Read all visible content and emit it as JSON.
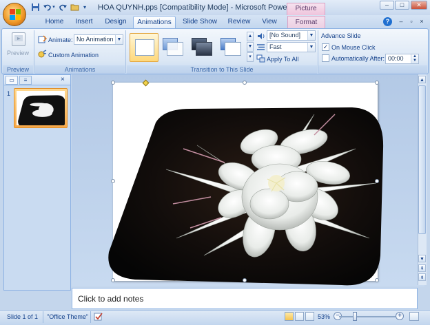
{
  "window": {
    "title": "HOA QUYNH.pps [Compatibility Mode] - Microsoft PowerPoint...",
    "contextual_tab_group": "Picture Tools",
    "controls": {
      "minimize": "–",
      "maximize": "□",
      "close": "✕"
    }
  },
  "quick_access_icons": [
    "save-icon",
    "undo-icon",
    "redo-icon",
    "open-folder-icon",
    "customize-qat-icon"
  ],
  "tabs": [
    "Home",
    "Insert",
    "Design",
    "Animations",
    "Slide Show",
    "Review",
    "View",
    "Format"
  ],
  "active_tab": "Animations",
  "ribbon": {
    "preview": {
      "button_label": "Preview",
      "group_label": "Preview"
    },
    "animations": {
      "animate_label": "Animate:",
      "animate_value": "No Animation",
      "custom_animation_label": "Custom Animation",
      "group_label": "Animations"
    },
    "transition": {
      "sound_value": "[No Sound]",
      "speed_value": "Fast",
      "apply_to_all_label": "Apply To All",
      "group_label": "Transition to This Slide",
      "gallery_icons": [
        "no-transition-icon",
        "fade-smoothly-icon",
        "fade-through-black-icon",
        "cut-transition-icon"
      ]
    },
    "advance": {
      "title": "Advance Slide",
      "on_mouse_click_label": "On Mouse Click",
      "on_mouse_click_checked": true,
      "auto_after_label": "Automatically After:",
      "auto_after_checked": false,
      "auto_after_value": "00:00"
    }
  },
  "slide_pane": {
    "slide_number": "1"
  },
  "notes": {
    "placeholder": "Click to add notes"
  },
  "status": {
    "slide_info": "Slide 1 of 1",
    "theme": "\"Office Theme\"",
    "zoom": "53%"
  },
  "colors": {
    "accent": "#15428b",
    "ribbon_bg": "#dbe7f5",
    "context_tab": "#efc3dc",
    "selected_thumb": "#f7a94a"
  }
}
